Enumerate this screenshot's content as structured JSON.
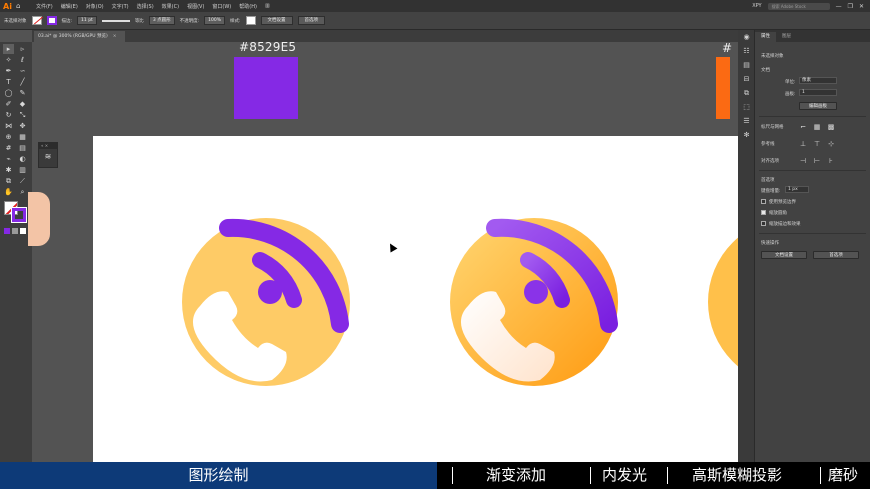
{
  "app": {
    "logo": "Ai",
    "home_icon": "home-icon",
    "menu": [
      "文件(F)",
      "编辑(E)",
      "对象(O)",
      "文字(T)",
      "选择(S)",
      "效果(C)",
      "视图(V)",
      "窗口(W)",
      "帮助(H)"
    ],
    "workspace_switch": "▥",
    "workspace_name": "XPY",
    "search_placeholder": "搜索 Adobe Stock",
    "window_controls": [
      "—",
      "❐",
      "✕"
    ]
  },
  "control_bar": {
    "selection_label": "未选择对象",
    "stroke_label": "描边:",
    "stroke_value": "11 pt",
    "stroke_style": "等比",
    "brush_label": "3 点圆形",
    "opacity_label": "不透明度:",
    "opacity_value": "100%",
    "style_label": "样式:",
    "doc_setup": "文档设置",
    "preferences": "首选项"
  },
  "document": {
    "tab_title": "03.ai* @ 300% (RGB/GPU 预览)"
  },
  "canvas": {
    "color_label": "#8529E5",
    "right_partial_label": "#",
    "swatch_color": "#8529e5",
    "orange_color": "#fb6a13",
    "icon_colors": {
      "purple": "#8529e5",
      "yellow": "#fecb66",
      "orange": "#ffa61d",
      "white": "#ffffff"
    }
  },
  "properties": {
    "tabs": [
      "属性",
      "图层"
    ],
    "no_selection": "未选择对象",
    "document_section": "文档",
    "units_label": "单位:",
    "units_value": "像素",
    "artboard_label": "画板:",
    "artboard_value": "1",
    "edit_artboards": "编辑画板",
    "ruler_grid": "标尺与网格",
    "guides": "参考线",
    "snap": "对齐选项",
    "preferences_section": "首选项",
    "keyboard_increment_label": "键盘增量:",
    "keyboard_increment_value": "1 px",
    "preview_bounds": "使用预览边界",
    "scale_corners": "缩放圆角",
    "scale_strokes": "缩放描边和效果",
    "quick_actions": "快速操作",
    "doc_setup_btn": "文档设置",
    "preferences_btn": "首选项"
  },
  "banner": {
    "left": "图形绘制",
    "items": [
      "渐变添加",
      "内发光",
      "高斯模糊投影",
      "磨砂"
    ]
  }
}
